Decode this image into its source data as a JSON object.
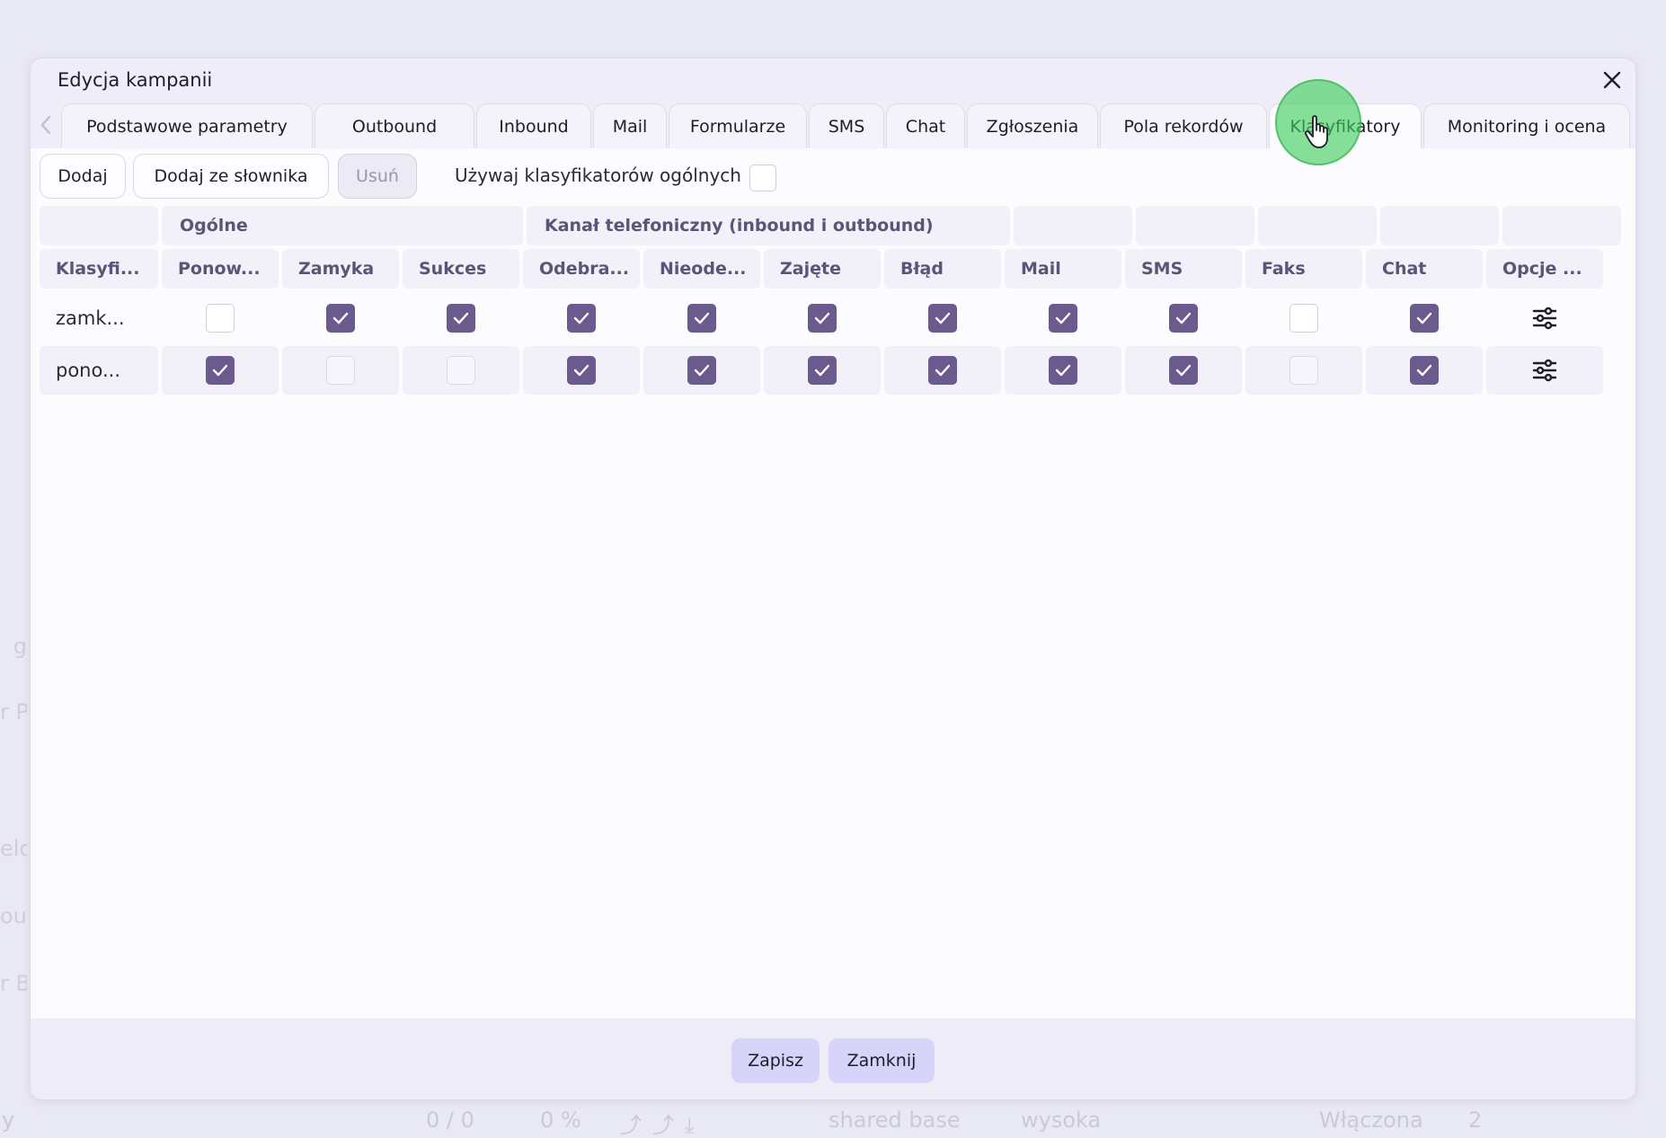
{
  "background": {
    "left_fragments": [
      "g",
      "r P",
      "elov",
      "out",
      "r B"
    ],
    "bottom_row": {
      "first": "y",
      "count": "0 / 0",
      "percent": "0 %",
      "base": "shared base",
      "priority": "wysoka",
      "state": "Włączona",
      "number": "2"
    }
  },
  "dialog": {
    "title": "Edycja kampanii",
    "tabs": [
      "Podstawowe parametry",
      "Outbound",
      "Inbound",
      "Mail",
      "Formularze",
      "SMS",
      "Chat",
      "Zgłoszenia",
      "Pola rekordów",
      "Klasyfikatory",
      "Monitoring i ocena"
    ],
    "active_tab": "Klasyfikatory"
  },
  "toolbar": {
    "add_label": "Dodaj",
    "add_from_dict_label": "Dodaj ze słownika",
    "remove_label": "Usuń",
    "use_general_label": "Używaj klasyfikatorów ogólnych",
    "use_general_checked": false
  },
  "table": {
    "groups": {
      "general": "Ogólne",
      "phone": "Kanał telefoniczny (inbound i outbound)"
    },
    "headers": [
      "Klasyfi...",
      "Ponow...",
      "Zamyka",
      "Sukces",
      "Odebra...",
      "Nieode...",
      "Zajęte",
      "Błąd",
      "Mail",
      "SMS",
      "Faks",
      "Chat",
      "Opcje ..."
    ],
    "rows": [
      {
        "name": "zamk...",
        "checks": [
          false,
          true,
          true,
          true,
          true,
          true,
          true,
          true,
          true,
          false,
          true
        ]
      },
      {
        "name": "pono...",
        "checks": [
          true,
          false,
          false,
          true,
          true,
          true,
          true,
          true,
          true,
          false,
          true
        ]
      }
    ]
  },
  "footer": {
    "save_label": "Zapisz",
    "close_label": "Zamknij"
  },
  "colors": {
    "accent": "#6b5a8e",
    "footer_button": "#d6d4f9",
    "cursor_halo": "#3ccd5a"
  },
  "icons": [
    "close-icon",
    "chevron-left-icon",
    "chevron-right-icon",
    "hand-cursor-icon",
    "checkmark-icon",
    "sliders-icon"
  ]
}
